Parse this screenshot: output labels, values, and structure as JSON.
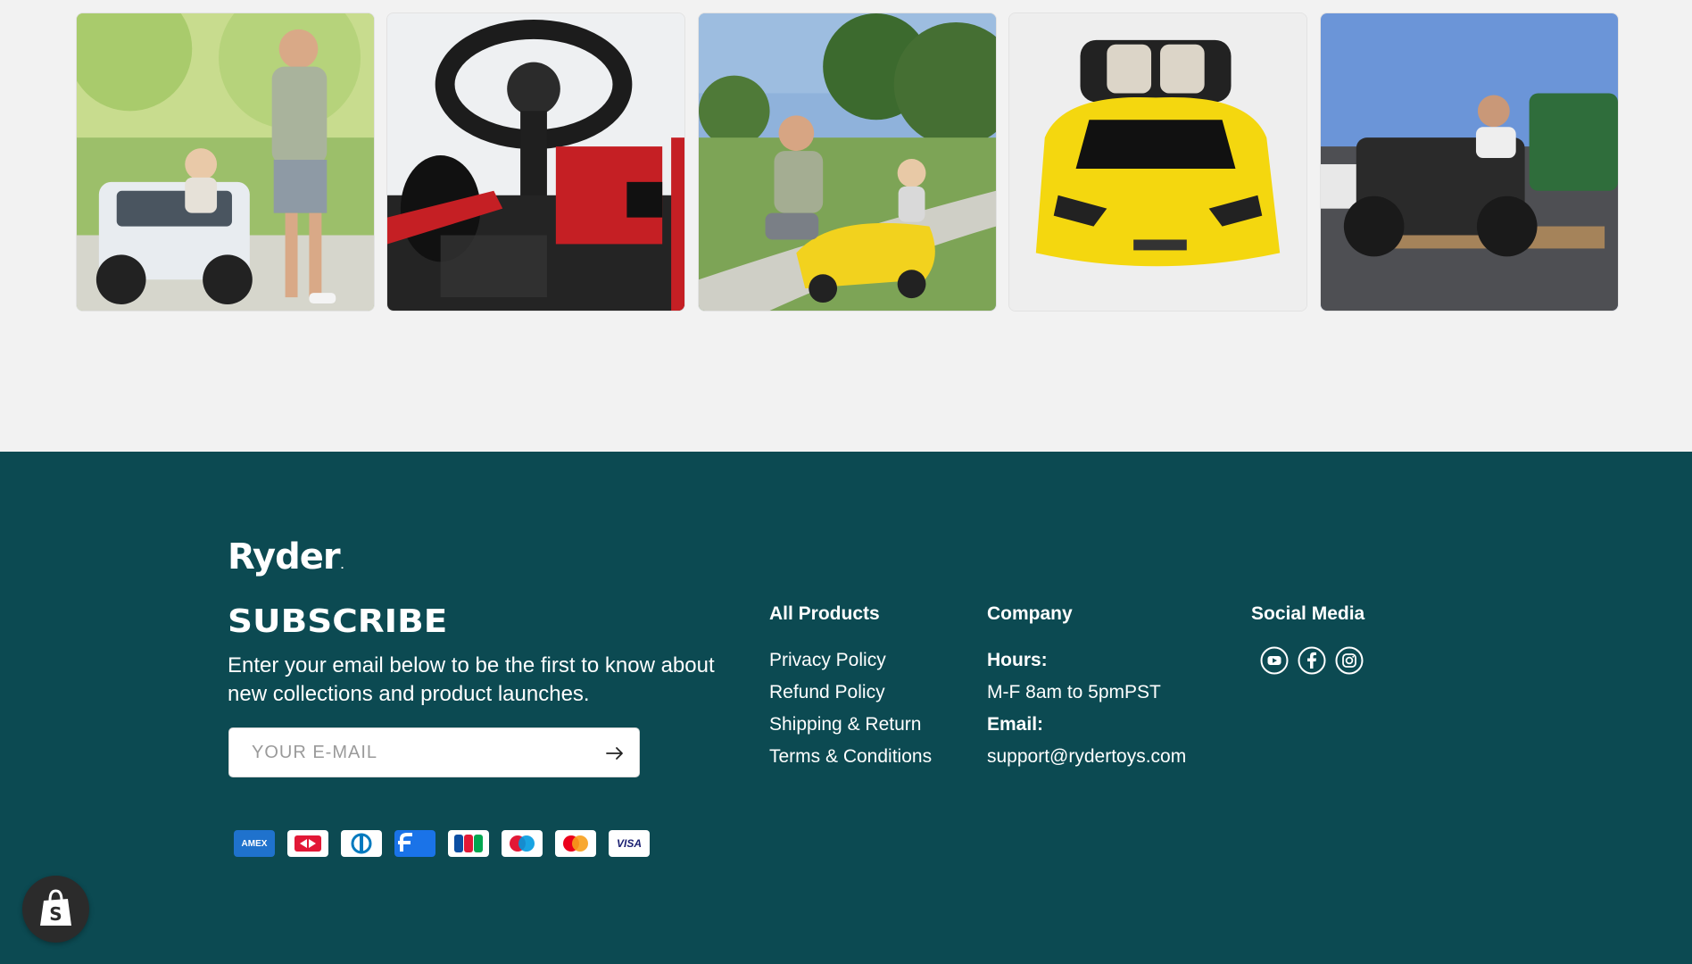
{
  "gallery": {
    "images": [
      {
        "alt": "Father and daughter with white ride-on UTV"
      },
      {
        "alt": "Red go-kart steering wheel close-up"
      },
      {
        "alt": "Father high-fiving daughter in yellow ride-on car"
      },
      {
        "alt": "Yellow ride-on sports car front view"
      },
      {
        "alt": "Man on black ride-on UTV on pallet"
      }
    ]
  },
  "footer": {
    "logo_text": "Ryder",
    "logo_mark": ".",
    "subscribe": {
      "title": "SUBSCRIBE",
      "description": "Enter your email below to be the first to know about new collections and product launches.",
      "email_placeholder": "YOUR E-MAIL",
      "email_value": ""
    },
    "payments": [
      {
        "name": "American Express",
        "label": "AMEX",
        "icon": "amex-icon"
      },
      {
        "name": "Diners Club (Discover style)",
        "label": "",
        "icon": "dci-icon"
      },
      {
        "name": "Diners Club",
        "label": "",
        "icon": "diners-icon"
      },
      {
        "name": "Facebook Pay",
        "label": "",
        "icon": "fpay-icon"
      },
      {
        "name": "JCB",
        "label": "JCB",
        "icon": "jcb-icon"
      },
      {
        "name": "Maestro",
        "label": "",
        "icon": "maestro-icon"
      },
      {
        "name": "Mastercard",
        "label": "",
        "icon": "mastercard-icon"
      },
      {
        "name": "Visa",
        "label": "VISA",
        "icon": "visa-icon"
      }
    ],
    "all_products": {
      "title": "All Products",
      "links": [
        "Privacy Policy",
        "Refund Policy",
        "Shipping & Return",
        "Terms & Conditions"
      ]
    },
    "company": {
      "title": "Company",
      "hours_label": "Hours:",
      "hours_value": "M-F 8am to 5pmPST",
      "email_label": "Email:",
      "email_value": "support@rydertoys.com"
    },
    "social": {
      "title": "Social Media",
      "icons": [
        "youtube-icon",
        "facebook-icon",
        "instagram-icon"
      ]
    }
  },
  "colors": {
    "footer_bg": "#0c4a52",
    "page_bg": "#f2f2f2",
    "text": "#ffffff"
  }
}
